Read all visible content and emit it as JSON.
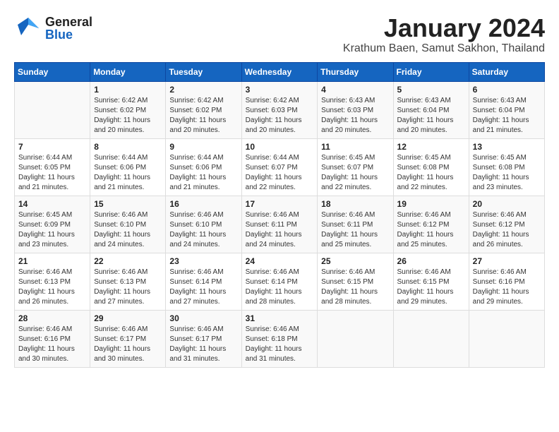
{
  "header": {
    "logo_general": "General",
    "logo_blue": "Blue",
    "month_title": "January 2024",
    "location": "Krathum Baen, Samut Sakhon, Thailand"
  },
  "calendar": {
    "days_of_week": [
      "Sunday",
      "Monday",
      "Tuesday",
      "Wednesday",
      "Thursday",
      "Friday",
      "Saturday"
    ],
    "weeks": [
      [
        {
          "day": "",
          "info": ""
        },
        {
          "day": "1",
          "info": "Sunrise: 6:42 AM\nSunset: 6:02 PM\nDaylight: 11 hours\nand 20 minutes."
        },
        {
          "day": "2",
          "info": "Sunrise: 6:42 AM\nSunset: 6:02 PM\nDaylight: 11 hours\nand 20 minutes."
        },
        {
          "day": "3",
          "info": "Sunrise: 6:42 AM\nSunset: 6:03 PM\nDaylight: 11 hours\nand 20 minutes."
        },
        {
          "day": "4",
          "info": "Sunrise: 6:43 AM\nSunset: 6:03 PM\nDaylight: 11 hours\nand 20 minutes."
        },
        {
          "day": "5",
          "info": "Sunrise: 6:43 AM\nSunset: 6:04 PM\nDaylight: 11 hours\nand 20 minutes."
        },
        {
          "day": "6",
          "info": "Sunrise: 6:43 AM\nSunset: 6:04 PM\nDaylight: 11 hours\nand 21 minutes."
        }
      ],
      [
        {
          "day": "7",
          "info": "Sunrise: 6:44 AM\nSunset: 6:05 PM\nDaylight: 11 hours\nand 21 minutes."
        },
        {
          "day": "8",
          "info": "Sunrise: 6:44 AM\nSunset: 6:06 PM\nDaylight: 11 hours\nand 21 minutes."
        },
        {
          "day": "9",
          "info": "Sunrise: 6:44 AM\nSunset: 6:06 PM\nDaylight: 11 hours\nand 21 minutes."
        },
        {
          "day": "10",
          "info": "Sunrise: 6:44 AM\nSunset: 6:07 PM\nDaylight: 11 hours\nand 22 minutes."
        },
        {
          "day": "11",
          "info": "Sunrise: 6:45 AM\nSunset: 6:07 PM\nDaylight: 11 hours\nand 22 minutes."
        },
        {
          "day": "12",
          "info": "Sunrise: 6:45 AM\nSunset: 6:08 PM\nDaylight: 11 hours\nand 22 minutes."
        },
        {
          "day": "13",
          "info": "Sunrise: 6:45 AM\nSunset: 6:08 PM\nDaylight: 11 hours\nand 23 minutes."
        }
      ],
      [
        {
          "day": "14",
          "info": "Sunrise: 6:45 AM\nSunset: 6:09 PM\nDaylight: 11 hours\nand 23 minutes."
        },
        {
          "day": "15",
          "info": "Sunrise: 6:46 AM\nSunset: 6:10 PM\nDaylight: 11 hours\nand 24 minutes."
        },
        {
          "day": "16",
          "info": "Sunrise: 6:46 AM\nSunset: 6:10 PM\nDaylight: 11 hours\nand 24 minutes."
        },
        {
          "day": "17",
          "info": "Sunrise: 6:46 AM\nSunset: 6:11 PM\nDaylight: 11 hours\nand 24 minutes."
        },
        {
          "day": "18",
          "info": "Sunrise: 6:46 AM\nSunset: 6:11 PM\nDaylight: 11 hours\nand 25 minutes."
        },
        {
          "day": "19",
          "info": "Sunrise: 6:46 AM\nSunset: 6:12 PM\nDaylight: 11 hours\nand 25 minutes."
        },
        {
          "day": "20",
          "info": "Sunrise: 6:46 AM\nSunset: 6:12 PM\nDaylight: 11 hours\nand 26 minutes."
        }
      ],
      [
        {
          "day": "21",
          "info": "Sunrise: 6:46 AM\nSunset: 6:13 PM\nDaylight: 11 hours\nand 26 minutes."
        },
        {
          "day": "22",
          "info": "Sunrise: 6:46 AM\nSunset: 6:13 PM\nDaylight: 11 hours\nand 27 minutes."
        },
        {
          "day": "23",
          "info": "Sunrise: 6:46 AM\nSunset: 6:14 PM\nDaylight: 11 hours\nand 27 minutes."
        },
        {
          "day": "24",
          "info": "Sunrise: 6:46 AM\nSunset: 6:14 PM\nDaylight: 11 hours\nand 28 minutes."
        },
        {
          "day": "25",
          "info": "Sunrise: 6:46 AM\nSunset: 6:15 PM\nDaylight: 11 hours\nand 28 minutes."
        },
        {
          "day": "26",
          "info": "Sunrise: 6:46 AM\nSunset: 6:15 PM\nDaylight: 11 hours\nand 29 minutes."
        },
        {
          "day": "27",
          "info": "Sunrise: 6:46 AM\nSunset: 6:16 PM\nDaylight: 11 hours\nand 29 minutes."
        }
      ],
      [
        {
          "day": "28",
          "info": "Sunrise: 6:46 AM\nSunset: 6:16 PM\nDaylight: 11 hours\nand 30 minutes."
        },
        {
          "day": "29",
          "info": "Sunrise: 6:46 AM\nSunset: 6:17 PM\nDaylight: 11 hours\nand 30 minutes."
        },
        {
          "day": "30",
          "info": "Sunrise: 6:46 AM\nSunset: 6:17 PM\nDaylight: 11 hours\nand 31 minutes."
        },
        {
          "day": "31",
          "info": "Sunrise: 6:46 AM\nSunset: 6:18 PM\nDaylight: 11 hours\nand 31 minutes."
        },
        {
          "day": "",
          "info": ""
        },
        {
          "day": "",
          "info": ""
        },
        {
          "day": "",
          "info": ""
        }
      ]
    ]
  }
}
